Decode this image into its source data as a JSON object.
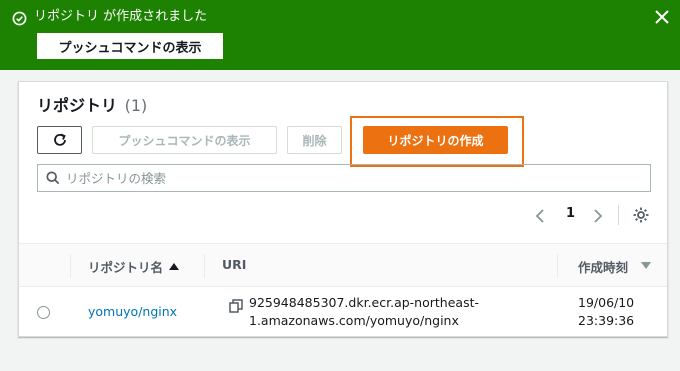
{
  "flash": {
    "message": "リポジトリ が作成されました",
    "push_button": "プッシュコマンドの表示",
    "status_color": "#1d8102"
  },
  "panel": {
    "title": "リポジトリ",
    "count": "(1)"
  },
  "toolbar": {
    "push_label": "プッシュコマンドの表示",
    "delete_label": "削除",
    "create_label": "リポジトリの作成",
    "accent": "#ec7211"
  },
  "search": {
    "placeholder": "リポジトリの検索"
  },
  "pagination": {
    "current_page": "1"
  },
  "table": {
    "columns": [
      "リポジトリ名",
      "URI",
      "作成時刻"
    ],
    "rows": [
      {
        "name": "yomuyo/nginx",
        "uri_line1": "925948485307.dkr.ecr.ap-northeast-",
        "uri_line2": "1.amazonaws.com/yomuyo/nginx",
        "created_line1": "19/06/10",
        "created_line2": "23:39:36"
      }
    ]
  }
}
